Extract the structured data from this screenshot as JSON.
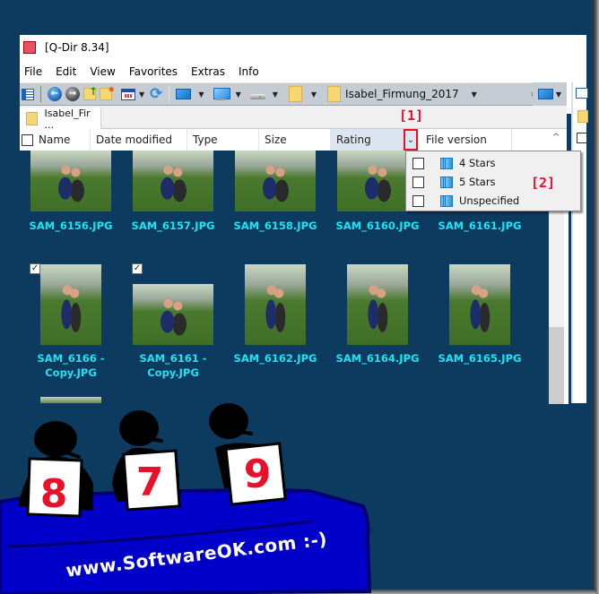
{
  "window": {
    "title": "[Q-Dir 8.34]",
    "menu": [
      "File",
      "Edit",
      "View",
      "Favorites",
      "Extras",
      "Info"
    ]
  },
  "toolbar": {
    "icons": [
      "pane-layout-icon",
      "back-icon",
      "forward-icon",
      "folder-up-icon",
      "new-folder-icon",
      "view-mode-icon",
      "refresh-icon",
      "desktop-icon",
      "this-pc-icon",
      "drive-icon",
      "folder-icon"
    ],
    "address_path": "Isabel_Firmung_2017"
  },
  "tab": {
    "label": "Isabel_Fir ..."
  },
  "columns": {
    "name": "Name",
    "date_modified": "Date modified",
    "type": "Type",
    "size": "Size",
    "rating": "Rating",
    "file_version": "File version"
  },
  "annotations": {
    "sort_button": "[1]",
    "filter_menu": "[2]"
  },
  "rating_filter": {
    "options": [
      {
        "label": "4 Stars",
        "checked": false
      },
      {
        "label": "5 Stars",
        "checked": false
      },
      {
        "label": "Unspecified",
        "checked": false
      }
    ]
  },
  "files": [
    {
      "name": "SAM_6156.JPG",
      "checked": false
    },
    {
      "name": "SAM_6157.JPG",
      "checked": false
    },
    {
      "name": "SAM_6158.JPG",
      "checked": false
    },
    {
      "name": "SAM_6160.JPG",
      "checked": false
    },
    {
      "name": "SAM_6161.JPG",
      "checked": false
    },
    {
      "name": "SAM_6166 - Copy.JPG",
      "line1": "SAM_6166 -",
      "line2": "Copy.JPG",
      "checked": true
    },
    {
      "name": "SAM_6161 - Copy.JPG",
      "line1": "SAM_6161 -",
      "line2": "Copy.JPG",
      "checked": true
    },
    {
      "name": "SAM_6162.JPG",
      "checked": false
    },
    {
      "name": "SAM_6164.JPG",
      "checked": false
    },
    {
      "name": "SAM_6165.JPG",
      "checked": false
    }
  ],
  "check_glyph": "✓",
  "promo": {
    "scores": [
      "8",
      "7",
      "9"
    ],
    "text": "www.SoftwareOK.com :-)"
  },
  "colors": {
    "background": "#0d3a5f",
    "filename": "#1ee3f5",
    "annotation_red": "#e8102a",
    "table_blue": "#0000c8"
  }
}
